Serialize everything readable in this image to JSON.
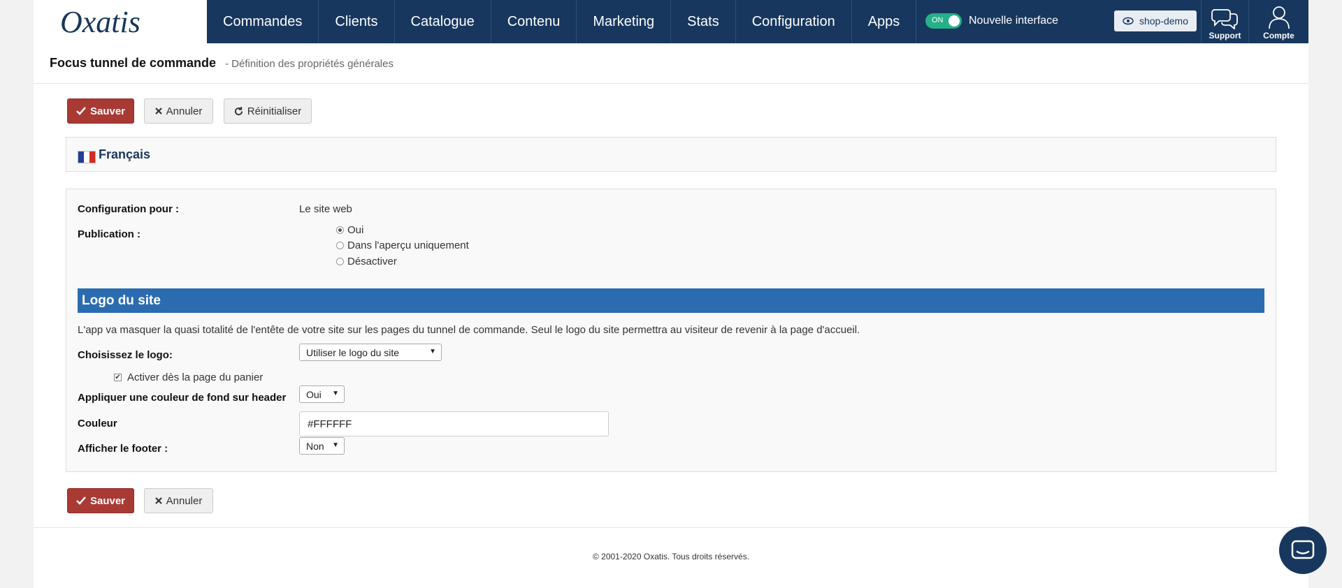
{
  "brand": {
    "logo_text": "Oxatis"
  },
  "nav": {
    "items": [
      {
        "label": "Commandes"
      },
      {
        "label": "Clients"
      },
      {
        "label": "Catalogue"
      },
      {
        "label": "Contenu"
      },
      {
        "label": "Marketing"
      },
      {
        "label": "Stats"
      },
      {
        "label": "Configuration"
      },
      {
        "label": "Apps"
      }
    ],
    "toggle_state": "ON",
    "toggle_label": "Nouvelle interface",
    "shop_label": "shop-demo",
    "support_label": "Support",
    "account_label": "Compte"
  },
  "header": {
    "title": "Focus tunnel de commande",
    "subtitle": "- Définition des propriétés générales"
  },
  "actions": {
    "save_label": "Sauver",
    "cancel_label": "Annuler",
    "reset_label": "Réinitialiser"
  },
  "language": {
    "label": "Français"
  },
  "form": {
    "config_label": "Configuration pour :",
    "config_value": "Le site web",
    "publication_label": "Publication :",
    "publication_options": [
      {
        "label": "Oui",
        "checked": true
      },
      {
        "label": "Dans l'aperçu uniquement",
        "checked": false
      },
      {
        "label": "Désactiver",
        "checked": false
      }
    ],
    "section_title": "Logo du site",
    "section_desc": "L'app va masquer la quasi totalité de l'entête de votre site sur les pages du tunnel de commande. Seul le logo du site permettra au visiteur de revenir à la page d'accueil.",
    "logo_label": "Choisissez le logo:",
    "logo_value": "Utiliser le logo du site",
    "cart_checkbox_label": "Activer dès la page du panier",
    "cart_checkbox_checked": true,
    "header_bg_label": "Appliquer une couleur de fond sur header",
    "header_bg_value": "Oui",
    "color_label": "Couleur",
    "color_value": "#FFFFFF",
    "footer_label": "Afficher le footer :",
    "footer_value": "Non"
  },
  "footer": {
    "copyright": "© 2001-2020 Oxatis. Tous droits réservés."
  },
  "colors": {
    "nav_bg": "#17375e",
    "save_bg": "#a83a33",
    "section_bg": "#2b6cb0",
    "toggle_on": "#26b087"
  }
}
